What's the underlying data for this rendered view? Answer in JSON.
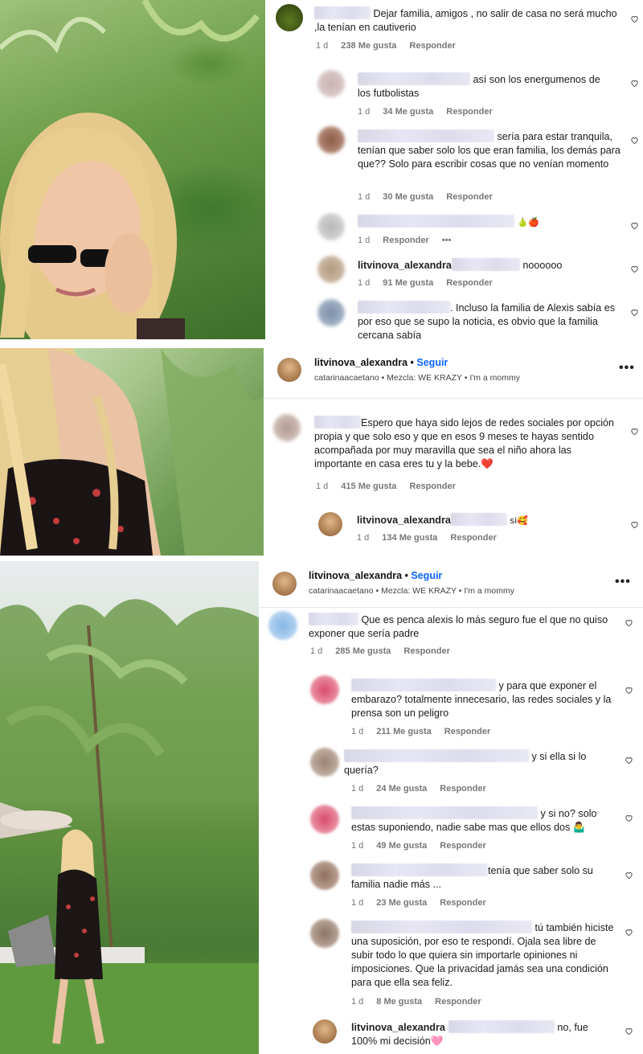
{
  "panel1": {
    "comments": [
      {
        "text": "Dejar familia, amigos , no salir de casa no será mucho ,la tenían en cautiverio",
        "time": "1 d",
        "likes": "238 Me gusta",
        "reply": "Responder"
      },
      {
        "text": "así son los energumenos de los futbolistas",
        "time": "1 d",
        "likes": "34 Me gusta",
        "reply": "Responder"
      },
      {
        "text": "sería para estar tranquila, tenían que saber solo los que eran familia, los demás para que?? Solo para escribir cosas que no venían momento",
        "time": "1 d",
        "likes": "30 Me gusta",
        "reply": "Responder"
      },
      {
        "text": "🍐🍎",
        "time": "1 d",
        "reply": "Responder",
        "more": "•••"
      },
      {
        "user": "litvinova_alexandra",
        "text": "noooooo",
        "time": "1 d",
        "likes": "91 Me gusta",
        "reply": "Responder"
      },
      {
        "text": ". Incluso la familia de Alexis sabía es por eso que se supo la noticia, es obvio que la familia cercana sabía"
      }
    ]
  },
  "panel2": {
    "header": {
      "username": "litvinova_alexandra",
      "dot": "•",
      "follow": "Seguir",
      "subtitle": "catarinaacaetano • Mezcla: WE KRAZY • I'm a mommy",
      "more": "•••"
    },
    "comments": [
      {
        "text": "Espero que haya sido lejos de redes sociales por opción propia y que solo eso y que en esos 9 meses te hayas sentido acompañada por muy maravilla que sea el niño ahora las importante en casa eres tu y la bebe.❤️",
        "time": "1 d",
        "likes": "415 Me gusta",
        "reply": "Responder"
      },
      {
        "user": "litvinova_alexandra",
        "text": "si🥰",
        "time": "1 d",
        "likes": "134 Me gusta",
        "reply": "Responder"
      }
    ]
  },
  "panel3": {
    "header": {
      "username": "litvinova_alexandra",
      "dot": "•",
      "follow": "Seguir",
      "subtitle": "catarinaacaetano • Mezcla: WE KRAZY • I'm a mommy",
      "more": "•••"
    },
    "comments": [
      {
        "text": "Que es penca alexis lo más seguro fue el que no quiso exponer que sería padre",
        "time": "1 d",
        "likes": "285 Me gusta",
        "reply": "Responder"
      },
      {
        "text": "y para que exponer el embarazo? totalmente innecesario, las redes sociales y la prensa son un peligro",
        "time": "1 d",
        "likes": "211 Me gusta",
        "reply": "Responder"
      },
      {
        "text": "y si ella si lo quería?",
        "time": "1 d",
        "likes": "24 Me gusta",
        "reply": "Responder"
      },
      {
        "text": "y si no? solo estas suponiendo, nadie sabe mas que ellos dos 🤷‍♂️",
        "time": "1 d",
        "likes": "49 Me gusta",
        "reply": "Responder"
      },
      {
        "text": "tenía que saber solo su familia nadie más ...",
        "time": "1 d",
        "likes": "23 Me gusta",
        "reply": "Responder"
      },
      {
        "text": "tú también hiciste una suposición, por eso te respondí. Ojala sea libre de subir todo lo que quiera sin importarle opiniones ni imposiciones. Que la privacidad jamás sea una condición para que ella sea feliz.",
        "time": "1 d",
        "likes": "8 Me gusta",
        "reply": "Responder"
      },
      {
        "user": "litvinova_alexandra",
        "text": "no, fue 100% mi decisión🩷"
      }
    ]
  },
  "colors": {
    "follow": "#0a66ff",
    "meta": "#777777",
    "background": "#ffffff"
  }
}
